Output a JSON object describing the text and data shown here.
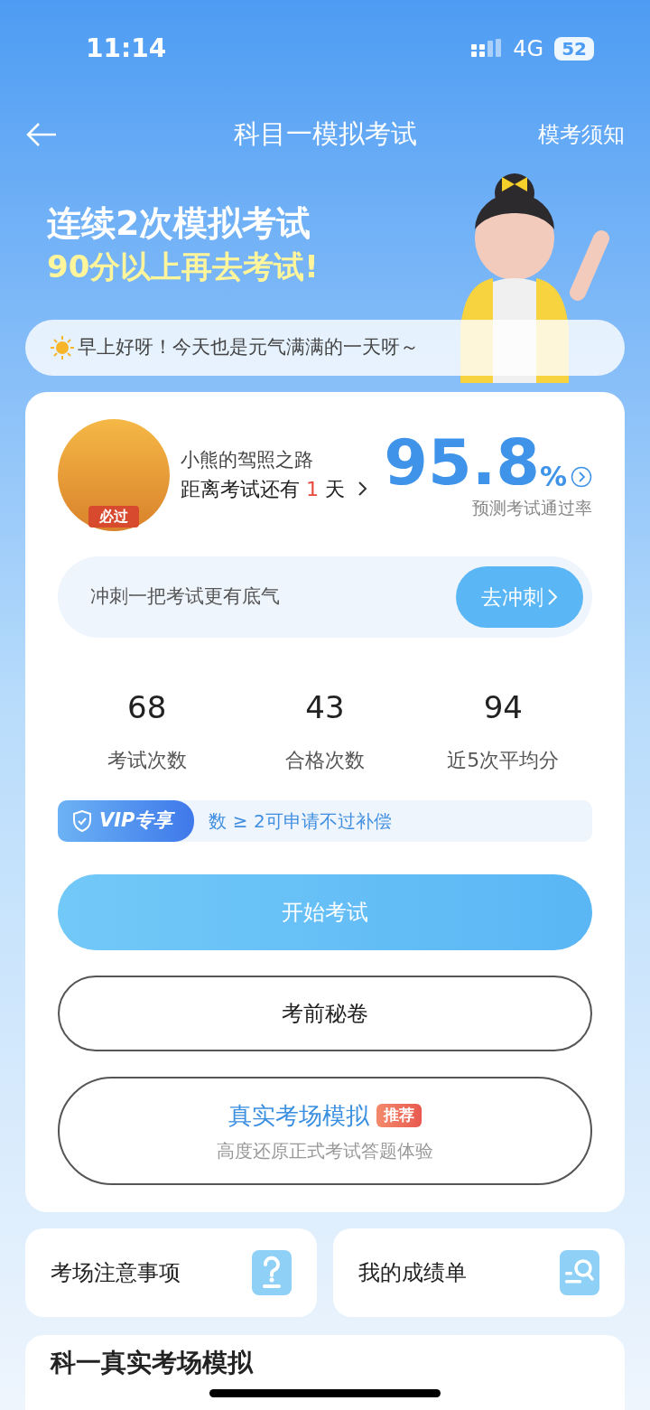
{
  "status_bar": {
    "time": "11:14",
    "network": "4G",
    "battery": "52"
  },
  "header": {
    "title": "科目一模拟考试",
    "action": "模考须知"
  },
  "banner": {
    "line1": "连续2次模拟考试",
    "line2": "90分以上再去考试!"
  },
  "greeting": "早上好呀！今天也是元气满满的一天呀～",
  "profile": {
    "name": "小熊的驾照之路",
    "badge": "必过",
    "countdown_prefix": "距离考试还有",
    "countdown_days": "1",
    "countdown_unit": "天",
    "pass_rate": "95.8",
    "pass_rate_unit": "%",
    "pass_rate_label": "预测考试通过率"
  },
  "sprint": {
    "text": "冲刺一把考试更有底气",
    "button": "去冲刺"
  },
  "stats": [
    {
      "value": "68",
      "label": "考试次数"
    },
    {
      "value": "43",
      "label": "合格次数"
    },
    {
      "value": "94",
      "label": "近5次平均分"
    }
  ],
  "vip": {
    "tag": "VIP专享",
    "text": "数 ≥ 2可申请不过补偿"
  },
  "buttons": [
    {
      "kind": "primary",
      "label": "开始考试"
    },
    {
      "kind": "outline",
      "label": "考前秘卷"
    },
    {
      "kind": "featured",
      "label": "真实考场模拟",
      "tag": "推荐",
      "subtitle": "高度还原正式考试答题体验"
    }
  ],
  "tiles": [
    {
      "kind": "help",
      "label": "考场注意事项"
    },
    {
      "kind": "report",
      "label": "我的成绩单"
    }
  ],
  "section_title": "科一真实考场模拟"
}
